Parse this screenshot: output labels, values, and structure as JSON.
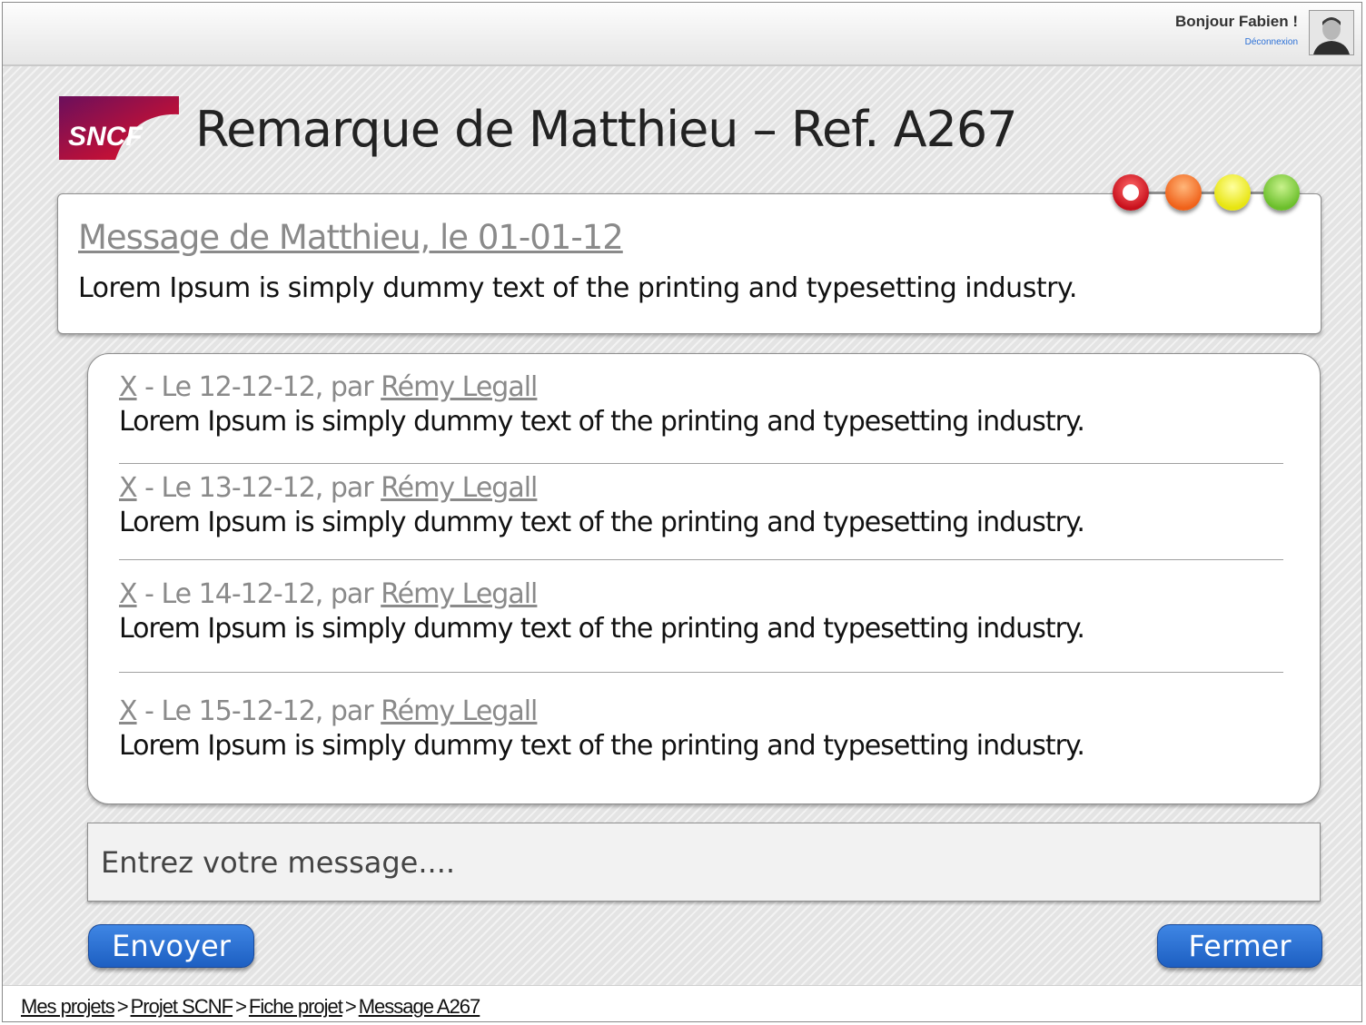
{
  "header": {
    "greeting": "Bonjour Fabien !",
    "logout_label": "Déconnexion"
  },
  "logo": {
    "text": "SNCF"
  },
  "page": {
    "title": "Remarque de Matthieu – Ref. A267"
  },
  "main_message": {
    "header": "Message de Matthieu, le 01-01-12",
    "body": "Lorem Ipsum is simply dummy text of the printing and typesetting industry."
  },
  "status_indicators": [
    {
      "name": "red",
      "color": "#d3161f",
      "selected": true
    },
    {
      "name": "orange",
      "color": "#f57a2e",
      "selected": false
    },
    {
      "name": "yellow",
      "color": "#f2ee2a",
      "selected": false
    },
    {
      "name": "green",
      "color": "#8cd04a",
      "selected": false
    }
  ],
  "comments": [
    {
      "delete": "X",
      "date_text": " - Le 12-12-12,  par ",
      "author": "Rémy Legall",
      "text": "Lorem Ipsum is simply dummy text of the printing and typesetting industry."
    },
    {
      "delete": "X",
      "date_text": " - Le 13-12-12,  par ",
      "author": "Rémy Legall",
      "text": "Lorem Ipsum is simply dummy text of the printing and typesetting industry."
    },
    {
      "delete": "X",
      "date_text": " - Le 14-12-12,  par ",
      "author": "Rémy Legall",
      "text": "Lorem Ipsum is simply dummy text of the printing and typesetting industry."
    },
    {
      "delete": "X",
      "date_text": " - Le 15-12-12,  par ",
      "author": "Rémy Legall",
      "text": "Lorem Ipsum is simply dummy text of the printing and typesetting industry."
    }
  ],
  "composer": {
    "placeholder": "Entrez votre message....",
    "value": ""
  },
  "actions": {
    "send_label": "Envoyer",
    "close_label": "Fermer"
  },
  "breadcrumb": {
    "items": [
      "Mes projets",
      "Projet SCNF",
      "Fiche projet",
      "Message A267"
    ],
    "separator": ">"
  },
  "colors": {
    "brand_gradient_start": "#6a0f5c",
    "brand_gradient_end": "#e0102a",
    "button_blue": "#2a6fd6"
  }
}
